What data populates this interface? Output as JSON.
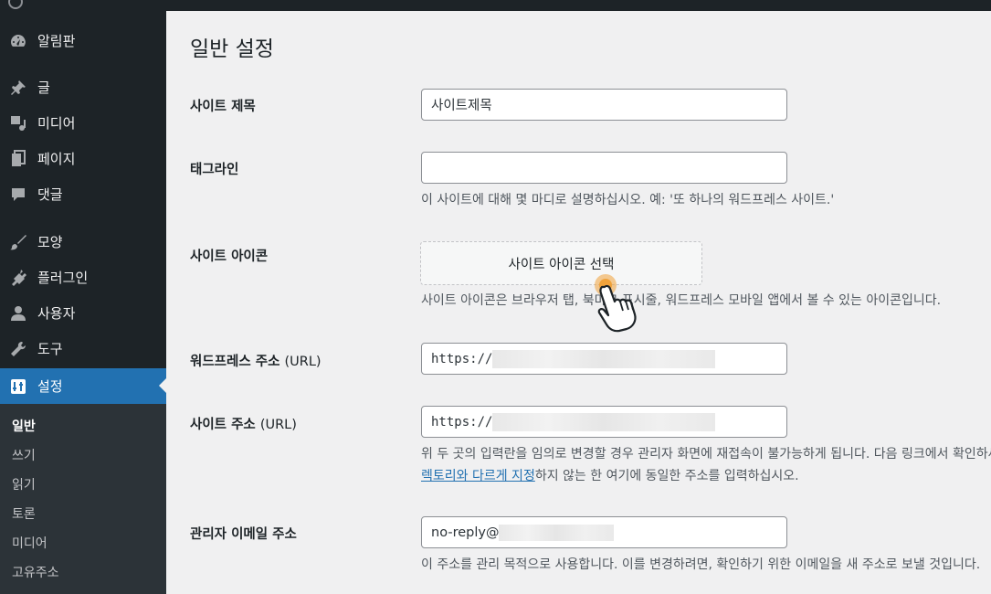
{
  "sidebar": {
    "items": [
      {
        "label": "알림판",
        "icon": "dashboard-icon"
      },
      {
        "label": "글",
        "icon": "pin-icon"
      },
      {
        "label": "미디어",
        "icon": "media-icon"
      },
      {
        "label": "페이지",
        "icon": "page-icon"
      },
      {
        "label": "댓글",
        "icon": "comment-icon"
      },
      {
        "label": "모양",
        "icon": "brush-icon"
      },
      {
        "label": "플러그인",
        "icon": "plugin-icon"
      },
      {
        "label": "사용자",
        "icon": "user-icon"
      },
      {
        "label": "도구",
        "icon": "wrench-icon"
      },
      {
        "label": "설정",
        "icon": "settings-icon"
      }
    ],
    "submenu": [
      "일반",
      "쓰기",
      "읽기",
      "토론",
      "미디어",
      "고유주소"
    ]
  },
  "page": {
    "title": "일반 설정",
    "site_title": {
      "label": "사이트 제목",
      "value": "사이트제목"
    },
    "tagline": {
      "label": "태그라인",
      "value": "",
      "desc": "이 사이트에 대해 몇 마디로 설명하십시오. 예: '또 하나의 워드프레스 사이트.'"
    },
    "site_icon": {
      "label": "사이트 아이콘",
      "button": "사이트 아이콘 선택",
      "desc": "사이트 아이콘은 브라우저 탭, 북마크 표시줄, 워드프레스 모바일 앱에서 볼 수 있는 아이콘입니다."
    },
    "wp_address": {
      "label": "워드프레스 주소",
      "label_suffix": "(URL)",
      "value": "https://"
    },
    "site_address": {
      "label": "사이트 주소",
      "label_suffix": "(URL)",
      "value": "https://",
      "desc1": "위 두 곳의 입력란을 임의로 변경할 경우 관리자 화면에 재접속이 불가능하게 됩니다. 다음 링크에서 확인하세요.",
      "desc_link": "렉토리와 다르게 지정",
      "desc2": "하지 않는 한 여기에 동일한 주소를 입력하십시오."
    },
    "admin_email": {
      "label": "관리자 이메일 주소",
      "value": "no-reply@",
      "desc": "이 주소를 관리 목적으로 사용합니다. 이를 변경하려면, 확인하기 위한 이메일을 새 주소로 보낼 것입니다."
    }
  },
  "colors": {
    "sidebar": "#1d2327",
    "accent": "#2271b1",
    "cursor": "#f0a23b"
  }
}
